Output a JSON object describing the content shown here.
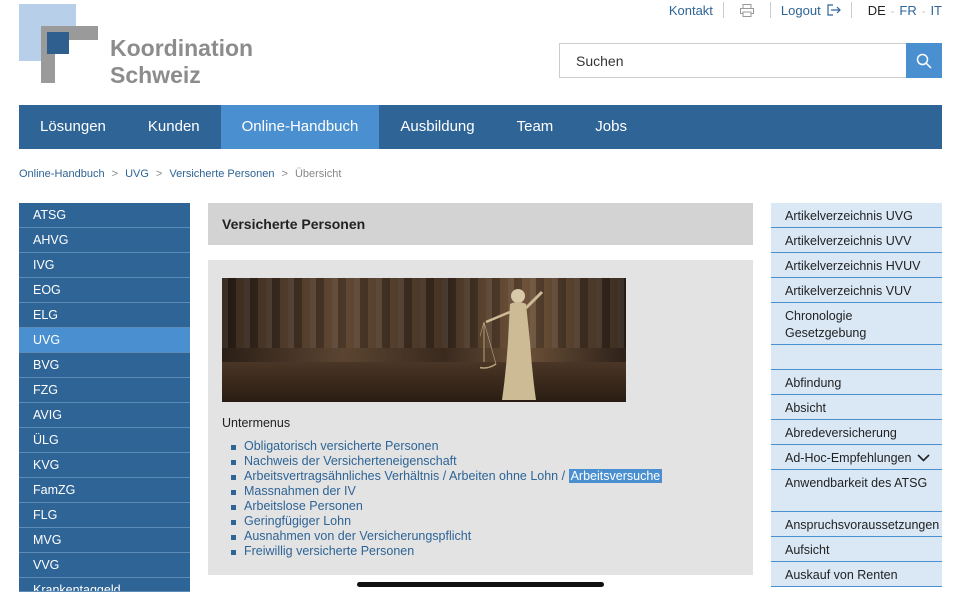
{
  "header": {
    "logo_line1": "Koordination",
    "logo_line2": "Schweiz",
    "kontakt": "Kontakt",
    "logout": "Logout",
    "languages": [
      "DE",
      "FR",
      "IT"
    ],
    "search_placeholder": "Suchen",
    "icons": {
      "print": "print-icon",
      "logout": "logout-icon",
      "search": "search-icon"
    }
  },
  "mainnav": {
    "items": [
      "Lösungen",
      "Kunden",
      "Online-Handbuch",
      "Ausbildung",
      "Team",
      "Jobs"
    ],
    "active": "Online-Handbuch"
  },
  "breadcrumb": {
    "items": [
      "Online-Handbuch",
      "UVG",
      "Versicherte Personen"
    ],
    "current": "Übersicht",
    "separator": ">"
  },
  "leftnav": {
    "items": [
      "ATSG",
      "AHVG",
      "IVG",
      "EOG",
      "ELG",
      "UVG",
      "BVG",
      "FZG",
      "AVIG",
      "ÜLG",
      "KVG",
      "FamZG",
      "FLG",
      "MVG",
      "VVG",
      "Krankentaggeld"
    ],
    "active": "UVG"
  },
  "content": {
    "title": "Versicherte Personen",
    "submenu_title": "Untermenus",
    "submenu": [
      "Obligatorisch versicherte Personen",
      "Nachweis der Versicherteneigenschaft",
      "Massnahmen der IV",
      "Arbeitslose Personen",
      "Geringfügiger Lohn",
      "Ausnahmen von der Versicherungspflicht",
      "Freiwillig versicherte Personen"
    ],
    "submenu_multi": {
      "part1": "Arbeitsvertragsähnliches Verhältnis",
      "part2": "Arbeiten ohne Lohn",
      "part3": "Arbeitsversuche",
      "separator": "/"
    }
  },
  "rightnav": {
    "items": [
      "Artikelverzeichnis UVG",
      "Artikelverzeichnis UVV",
      "Artikelverzeichnis HVUV",
      "Artikelverzeichnis VUV",
      "Chronologie Gesetzgebung",
      "",
      "Abfindung",
      "Absicht",
      "Abredeversicherung",
      "Ad-Hoc-Empfehlungen",
      "Anwendbarkeit des ATSG",
      "Anspruchsvoraussetzungen",
      "Aufsicht",
      "Auskauf von Renten"
    ],
    "expand_icon": "chevron-down-icon"
  },
  "colors": {
    "nav_blue": "#2e6496",
    "active_blue": "#4a90d0",
    "light_blue": "#dae8f6",
    "gray_head": "#d3d3d3",
    "gray_box": "#e3e3e3"
  }
}
